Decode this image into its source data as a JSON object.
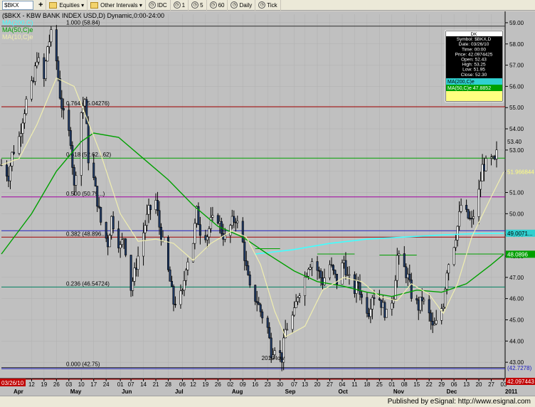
{
  "toolbar": {
    "symbol_label": "$BKX",
    "equities_label": "Equities",
    "intervals_label": "Other Intervals",
    "idc_label": "IDC",
    "n1_label": "1",
    "n5_label": "5",
    "n60_label": "60",
    "daily_label": "Daily",
    "tick_label": "Tick"
  },
  "header": {
    "title": "($BKX - KBW BANK INDEX USD,D) Dynamic,0:00-24:00",
    "ma200_label": "MA(200,C)",
    "ma50_label": "MA(50,C)e",
    "ma10_label": "MA(10,C)e"
  },
  "data_window": {
    "rows": [
      {
        "key": "DK",
        "value": ""
      },
      {
        "key": "Symbol",
        "value": "$BKX,D"
      },
      {
        "key": "Date",
        "value": "03/26/10"
      },
      {
        "key": "Time",
        "value": "00:00"
      },
      {
        "key": "Price",
        "value": "42.0974425"
      },
      {
        "key": "Open",
        "value": "52.43"
      },
      {
        "key": "High",
        "value": "53.25"
      },
      {
        "key": "Low",
        "value": "51.95"
      },
      {
        "key": "Close",
        "value": "52.30"
      }
    ],
    "ma200_row": "MA(200,C)e",
    "ma50_row": "MA(50,C)e  47.8852"
  },
  "footer": {
    "published": "Published by eSignal: http://www.esignal.com",
    "cursor_date": "03/26/10"
  },
  "colors": {
    "price_bar": "#1f3a66",
    "ma10": "#f0eeb0",
    "ma50": "#00a000",
    "ma200": "#40ffff"
  },
  "chart_data": {
    "type": "ohlc-bar",
    "y_axis": {
      "range": [
        42.3,
        59.4
      ],
      "ticks": [
        "59.00",
        "58.00",
        "57.00",
        "56.00",
        "55.00",
        "54.00",
        "53.00",
        "52.00",
        "51.00",
        "50.00",
        "49.00",
        "48.00",
        "47.00",
        "46.00",
        "45.00",
        "44.00",
        "43.00"
      ]
    },
    "x_axis": {
      "range_dates": [
        "2010-03-26",
        "2011-01-03"
      ],
      "ticks": [
        {
          "date": "2010-04-12",
          "label": "12"
        },
        {
          "date": "2010-04-19",
          "label": "19"
        },
        {
          "date": "2010-04-26",
          "label": "26"
        },
        {
          "date": "2010-05-03",
          "label": "03"
        },
        {
          "date": "2010-05-10",
          "label": "10"
        },
        {
          "date": "2010-05-17",
          "label": "17"
        },
        {
          "date": "2010-05-24",
          "label": "24"
        },
        {
          "date": "2010-06-01",
          "label": "01"
        },
        {
          "date": "2010-06-07",
          "label": "07"
        },
        {
          "date": "2010-06-14",
          "label": "14"
        },
        {
          "date": "2010-06-21",
          "label": "21"
        },
        {
          "date": "2010-06-28",
          "label": "28"
        },
        {
          "date": "2010-07-06",
          "label": "06"
        },
        {
          "date": "2010-07-12",
          "label": "12"
        },
        {
          "date": "2010-07-19",
          "label": "19"
        },
        {
          "date": "2010-07-26",
          "label": "26"
        },
        {
          "date": "2010-08-02",
          "label": "02"
        },
        {
          "date": "2010-08-09",
          "label": "09"
        },
        {
          "date": "2010-08-16",
          "label": "16"
        },
        {
          "date": "2010-08-23",
          "label": "23"
        },
        {
          "date": "2010-08-30",
          "label": "30"
        },
        {
          "date": "2010-09-07",
          "label": "07"
        },
        {
          "date": "2010-09-13",
          "label": "13"
        },
        {
          "date": "2010-09-20",
          "label": "20"
        },
        {
          "date": "2010-09-27",
          "label": "27"
        },
        {
          "date": "2010-10-04",
          "label": "04"
        },
        {
          "date": "2010-10-11",
          "label": "11"
        },
        {
          "date": "2010-10-18",
          "label": "18"
        },
        {
          "date": "2010-10-25",
          "label": "25"
        },
        {
          "date": "2010-11-01",
          "label": "01"
        },
        {
          "date": "2010-11-08",
          "label": "08"
        },
        {
          "date": "2010-11-15",
          "label": "15"
        },
        {
          "date": "2010-11-22",
          "label": "22"
        },
        {
          "date": "2010-11-29",
          "label": "29"
        },
        {
          "date": "2010-12-06",
          "label": "06"
        },
        {
          "date": "2010-12-13",
          "label": "13"
        },
        {
          "date": "2010-12-20",
          "label": "20"
        },
        {
          "date": "2010-12-27",
          "label": "27"
        },
        {
          "date": "2011-01-03",
          "label": "03"
        }
      ],
      "months": [
        {
          "date": "2010-04-01",
          "label": "Apr"
        },
        {
          "date": "2010-05-03",
          "label": "May"
        },
        {
          "date": "2010-06-01",
          "label": "Jun"
        },
        {
          "date": "2010-07-01",
          "label": "Jul"
        },
        {
          "date": "2010-08-02",
          "label": "Aug"
        },
        {
          "date": "2010-09-01",
          "label": "Sep"
        },
        {
          "date": "2010-10-01",
          "label": "Oct"
        },
        {
          "date": "2010-11-01",
          "label": "Nov"
        },
        {
          "date": "2010-12-01",
          "label": "Dec"
        },
        {
          "date": "2011-01-03",
          "label": "2011"
        }
      ]
    },
    "fibonacci": [
      {
        "level": 58.84,
        "label": "1.000 (58.84)",
        "color": "#303030"
      },
      {
        "level": 55.04,
        "label": "0.764 (55.04276)",
        "color": "#a00000"
      },
      {
        "level": 52.62,
        "label": "0.618 (52.62...62)",
        "color": "#00a000"
      },
      {
        "level": 50.79,
        "label": "0.500 (50.79...)",
        "color": "#a000a0"
      },
      {
        "level": 48.896,
        "label": "0.382 (48.896...)",
        "color": "#a00000"
      },
      {
        "level": 46.54724,
        "label": "0.236 (46.54724)",
        "color": "#008060"
      },
      {
        "level": 42.75,
        "label": "0.000 (42.75)",
        "color": "#303030"
      }
    ],
    "horizontal_lines": [
      {
        "level": 49.2,
        "color": "#2020c0"
      },
      {
        "level": 42.2,
        "color": "#c00000"
      },
      {
        "level": 42.7,
        "color": "#2020c0"
      }
    ],
    "annotations": [
      {
        "date": "2010-08-26",
        "price": 43.1,
        "text": "2010 low"
      }
    ],
    "right_labels": [
      {
        "value": 53.4,
        "text": "53.40",
        "bg": "#c0c0c0",
        "fg": "#000000"
      },
      {
        "value": 51.97,
        "text": "51.966844",
        "bg": "#c0c0c0",
        "fg": "#ffff80"
      },
      {
        "value": 49.08,
        "text": "49.0071...",
        "bg": "#30d0d0",
        "fg": "#000000"
      },
      {
        "value": 48.09,
        "text": "48.0896",
        "bg": "#00a000",
        "fg": "#ffffff"
      },
      {
        "value": 42.73,
        "text": "(42.7278)",
        "bg": "#c0c0c0",
        "fg": "#2020c0"
      },
      {
        "value": 42.1,
        "text": "42.097443",
        "bg": "#c00000",
        "fg": "#ffffff"
      }
    ],
    "close_path": [
      [
        "2010-03-26",
        52.3
      ],
      [
        "2010-03-30",
        51.8
      ],
      [
        "2010-04-01",
        52.8
      ],
      [
        "2010-04-05",
        53.6
      ],
      [
        "2010-04-07",
        54.5
      ],
      [
        "2010-04-09",
        55.3
      ],
      [
        "2010-04-13",
        56.2
      ],
      [
        "2010-04-15",
        57.4
      ],
      [
        "2010-04-19",
        56.3
      ],
      [
        "2010-04-21",
        57.9
      ],
      [
        "2010-04-23",
        58.4
      ],
      [
        "2010-04-26",
        57.2
      ],
      [
        "2010-04-28",
        55.6
      ],
      [
        "2010-04-30",
        54.6
      ],
      [
        "2010-05-04",
        53.5
      ],
      [
        "2010-05-06",
        51.2
      ],
      [
        "2010-05-10",
        54.8
      ],
      [
        "2010-05-12",
        55.4
      ],
      [
        "2010-05-14",
        52.6
      ],
      [
        "2010-05-17",
        51.6
      ],
      [
        "2010-05-19",
        50.6
      ],
      [
        "2010-05-21",
        49.6
      ],
      [
        "2010-05-25",
        48.6
      ],
      [
        "2010-05-27",
        49.8
      ],
      [
        "2010-06-01",
        48.4
      ],
      [
        "2010-06-03",
        48.9
      ],
      [
        "2010-06-07",
        46.5
      ],
      [
        "2010-06-09",
        47.2
      ],
      [
        "2010-06-11",
        48.0
      ],
      [
        "2010-06-15",
        49.5
      ],
      [
        "2010-06-17",
        50.1
      ],
      [
        "2010-06-21",
        50.6
      ],
      [
        "2010-06-23",
        49.4
      ],
      [
        "2010-06-25",
        48.6
      ],
      [
        "2010-06-29",
        46.8
      ],
      [
        "2010-07-01",
        45.8
      ],
      [
        "2010-07-06",
        46.2
      ],
      [
        "2010-07-08",
        47.6
      ],
      [
        "2010-07-12",
        48.7
      ],
      [
        "2010-07-14",
        50.1
      ],
      [
        "2010-07-16",
        49.2
      ],
      [
        "2010-07-20",
        49.0
      ],
      [
        "2010-07-22",
        49.6
      ],
      [
        "2010-07-26",
        49.8
      ],
      [
        "2010-07-28",
        49.2
      ],
      [
        "2010-07-30",
        48.8
      ],
      [
        "2010-08-03",
        49.6
      ],
      [
        "2010-08-05",
        49.8
      ],
      [
        "2010-08-09",
        48.6
      ],
      [
        "2010-08-11",
        47.4
      ],
      [
        "2010-08-13",
        46.4
      ],
      [
        "2010-08-17",
        45.9
      ],
      [
        "2010-08-19",
        45.4
      ],
      [
        "2010-08-23",
        44.6
      ],
      [
        "2010-08-25",
        43.5
      ],
      [
        "2010-08-27",
        43.8
      ],
      [
        "2010-08-31",
        43.2
      ],
      [
        "2010-09-02",
        44.5
      ],
      [
        "2010-09-07",
        45.3
      ],
      [
        "2010-09-09",
        46.2
      ],
      [
        "2010-09-13",
        47.0
      ],
      [
        "2010-09-15",
        47.6
      ],
      [
        "2010-09-17",
        47.8
      ],
      [
        "2010-09-21",
        47.2
      ],
      [
        "2010-09-23",
        46.8
      ],
      [
        "2010-09-27",
        47.6
      ],
      [
        "2010-09-29",
        47.2
      ],
      [
        "2010-10-01",
        46.8
      ],
      [
        "2010-10-05",
        47.8
      ],
      [
        "2010-10-07",
        47.0
      ],
      [
        "2010-10-11",
        46.4
      ],
      [
        "2010-10-13",
        46.8
      ],
      [
        "2010-10-15",
        46.0
      ],
      [
        "2010-10-19",
        45.4
      ],
      [
        "2010-10-21",
        46.2
      ],
      [
        "2010-10-25",
        46.0
      ],
      [
        "2010-10-27",
        45.6
      ],
      [
        "2010-10-29",
        45.2
      ],
      [
        "2010-11-02",
        46.2
      ],
      [
        "2010-11-04",
        48.0
      ],
      [
        "2010-11-08",
        47.4
      ],
      [
        "2010-11-10",
        47.0
      ],
      [
        "2010-11-12",
        46.2
      ],
      [
        "2010-11-16",
        45.6
      ],
      [
        "2010-11-18",
        46.0
      ],
      [
        "2010-11-22",
        45.2
      ],
      [
        "2010-11-24",
        44.6
      ],
      [
        "2010-11-26",
        44.8
      ],
      [
        "2010-11-30",
        45.8
      ],
      [
        "2010-12-02",
        47.4
      ],
      [
        "2010-12-06",
        48.6
      ],
      [
        "2010-12-08",
        49.4
      ],
      [
        "2010-12-10",
        50.4
      ],
      [
        "2010-12-14",
        49.8
      ],
      [
        "2010-12-16",
        49.6
      ],
      [
        "2010-12-20",
        51.0
      ],
      [
        "2010-12-22",
        52.2
      ],
      [
        "2010-12-27",
        52.5
      ],
      [
        "2010-12-29",
        52.4
      ],
      [
        "2010-12-31",
        53.2
      ]
    ],
    "ma10_path": [
      [
        "2010-03-26",
        52.3
      ],
      [
        "2010-04-05",
        52.6
      ],
      [
        "2010-04-15",
        54.2
      ],
      [
        "2010-04-26",
        56.4
      ],
      [
        "2010-05-06",
        56.0
      ],
      [
        "2010-05-14",
        54.3
      ],
      [
        "2010-05-21",
        52.8
      ],
      [
        "2010-06-01",
        50.0
      ],
      [
        "2010-06-11",
        48.7
      ],
      [
        "2010-06-21",
        48.8
      ],
      [
        "2010-07-01",
        48.6
      ],
      [
        "2010-07-12",
        47.8
      ],
      [
        "2010-07-22",
        48.6
      ],
      [
        "2010-08-03",
        49.2
      ],
      [
        "2010-08-11",
        48.9
      ],
      [
        "2010-08-19",
        47.6
      ],
      [
        "2010-08-27",
        45.4
      ],
      [
        "2010-09-02",
        44.2
      ],
      [
        "2010-09-13",
        44.7
      ],
      [
        "2010-09-23",
        46.4
      ],
      [
        "2010-10-05",
        47.0
      ],
      [
        "2010-10-15",
        46.8
      ],
      [
        "2010-10-25",
        46.1
      ],
      [
        "2010-11-04",
        45.9
      ],
      [
        "2010-11-12",
        46.7
      ],
      [
        "2010-11-22",
        46.2
      ],
      [
        "2010-11-30",
        45.3
      ],
      [
        "2010-12-08",
        46.7
      ],
      [
        "2010-12-16",
        48.9
      ],
      [
        "2010-12-27",
        50.8
      ],
      [
        "2011-01-03",
        51.97
      ]
    ],
    "ma50_path": [
      [
        "2010-03-26",
        48.1
      ],
      [
        "2010-04-12",
        50.0
      ],
      [
        "2010-04-26",
        52.0
      ],
      [
        "2010-05-10",
        53.4
      ],
      [
        "2010-05-17",
        53.8
      ],
      [
        "2010-05-31",
        53.6
      ],
      [
        "2010-06-14",
        52.6
      ],
      [
        "2010-06-28",
        51.6
      ],
      [
        "2010-07-12",
        50.4
      ],
      [
        "2010-07-26",
        49.4
      ],
      [
        "2010-08-09",
        48.9
      ],
      [
        "2010-08-23",
        48.1
      ],
      [
        "2010-09-07",
        47.3
      ],
      [
        "2010-09-20",
        46.8
      ],
      [
        "2010-10-04",
        46.6
      ],
      [
        "2010-10-18",
        46.3
      ],
      [
        "2010-11-01",
        46.1
      ],
      [
        "2010-11-15",
        46.4
      ],
      [
        "2010-11-29",
        46.3
      ],
      [
        "2010-12-13",
        46.7
      ],
      [
        "2010-12-27",
        47.6
      ],
      [
        "2011-01-03",
        48.09
      ]
    ],
    "ma200_path": [
      [
        "2010-08-16",
        48.1
      ],
      [
        "2010-09-06",
        48.3
      ],
      [
        "2010-09-27",
        48.6
      ],
      [
        "2010-10-18",
        48.8
      ],
      [
        "2010-11-08",
        48.9
      ],
      [
        "2010-11-29",
        49.0
      ],
      [
        "2010-12-20",
        49.07
      ],
      [
        "2011-01-03",
        49.08
      ]
    ],
    "green_segments": [
      {
        "from": "2010-08-16",
        "to": "2010-08-30",
        "level": 48.35
      },
      {
        "from": "2010-09-20",
        "to": "2010-10-11",
        "level": 48.1
      },
      {
        "from": "2010-10-25",
        "to": "2010-11-15",
        "level": 48.05
      },
      {
        "from": "2010-12-06",
        "to": "2011-01-03",
        "level": 48.1
      }
    ]
  }
}
